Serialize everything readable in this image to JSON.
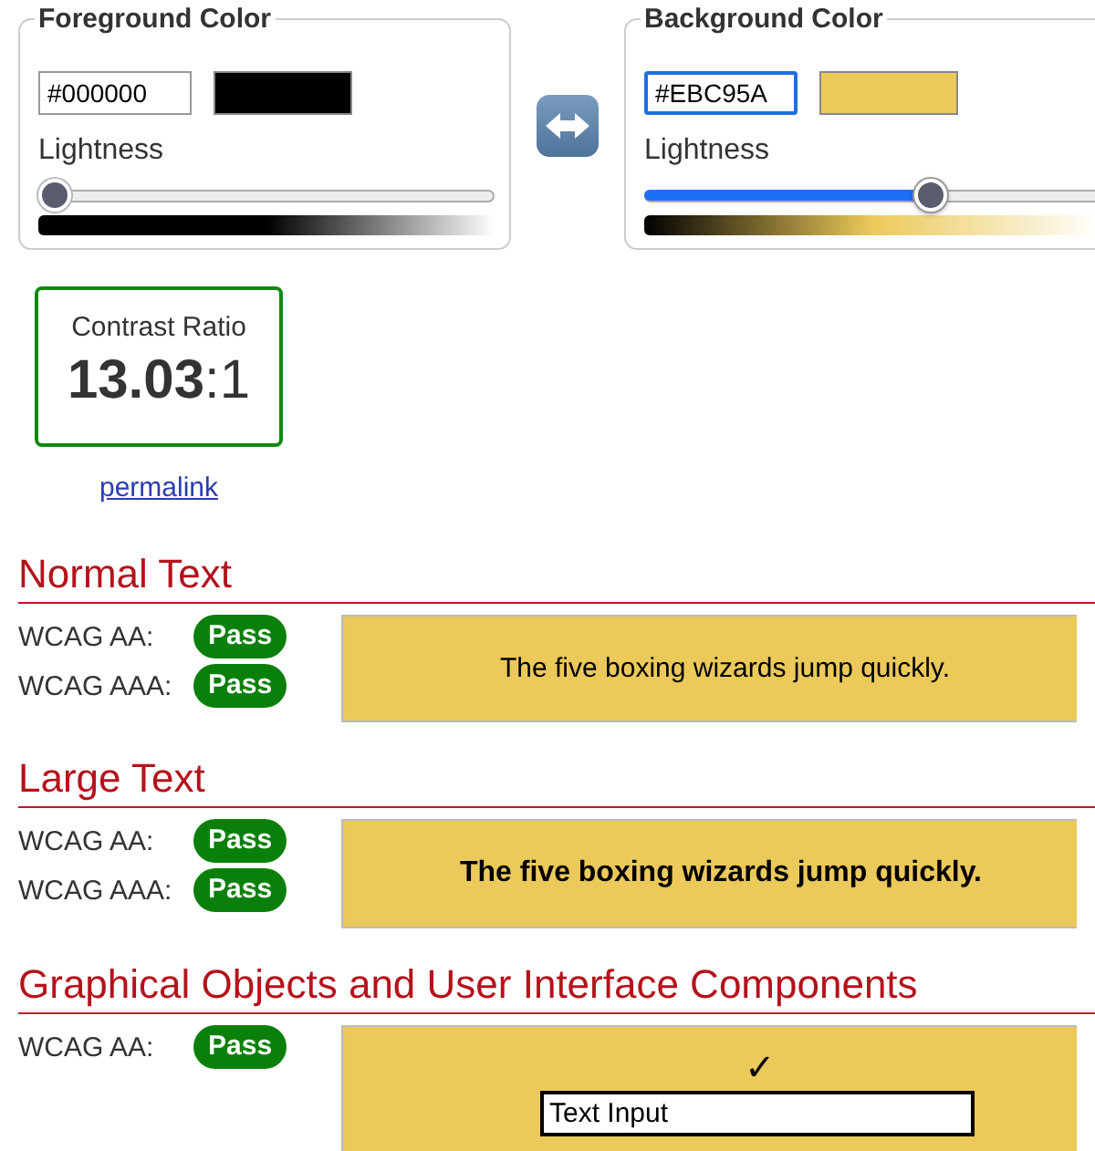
{
  "panels": [
    {
      "title": "Foreground Color",
      "hex": "#000000",
      "focused": false,
      "slider_label": "Lightness",
      "level": 0,
      "active": false
    },
    {
      "title": "Background Color",
      "hex": "#EBC95A",
      "focused": true,
      "slider_label": "Lightness",
      "level": 0.64,
      "active": true
    }
  ],
  "contrast": {
    "label": "Contrast Ratio",
    "value": "13.03",
    "suffix": ":1"
  },
  "permalink": "permalink",
  "sections": [
    {
      "heading": "Normal Text",
      "kind": "normal",
      "checks": [
        {
          "label": "WCAG AA:",
          "result": "Pass",
          "passed": true
        },
        {
          "label": "WCAG AAA:",
          "result": "Pass",
          "passed": true
        }
      ],
      "sample": "The five boxing wizards jump quickly."
    },
    {
      "heading": "Large Text",
      "kind": "large",
      "checks": [
        {
          "label": "WCAG AA:",
          "result": "Pass",
          "passed": true
        },
        {
          "label": "WCAG AAA:",
          "result": "Pass",
          "passed": true
        }
      ],
      "sample": "The five boxing wizards jump quickly."
    },
    {
      "heading": "Graphical Objects and User Interface Components",
      "kind": "ui",
      "checks": [
        {
          "label": "WCAG AA:",
          "result": "Pass",
          "passed": true
        }
      ],
      "checkmark": "✓",
      "input_value": "Text Input"
    }
  ]
}
